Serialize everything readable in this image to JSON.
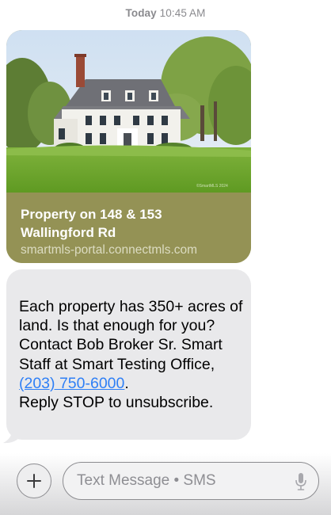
{
  "header": {
    "day": "Today",
    "time": "10:45 AM"
  },
  "link_preview": {
    "title": "Property on 148 & 153 Wallingford Rd",
    "domain": "smartmls-portal.connectmls.com",
    "photo_icon": "house-photo"
  },
  "message": {
    "text_before_link": "Each property has 350+ acres of land. Is that enough for you? Contact Bob Broker Sr. Smart Staff at Smart Testing Office, ",
    "phone_link": "(203) 750-6000",
    "text_after_link": ".",
    "reply_line": "Reply STOP to unsubscribe."
  },
  "compose": {
    "placeholder": "Text Message • SMS",
    "plus_icon": "plus-icon",
    "mic_icon": "microphone-icon"
  },
  "colors": {
    "incoming_bubble": "#e9e9eb",
    "link_card": "#949255",
    "link_text": "#2e7ff6"
  }
}
